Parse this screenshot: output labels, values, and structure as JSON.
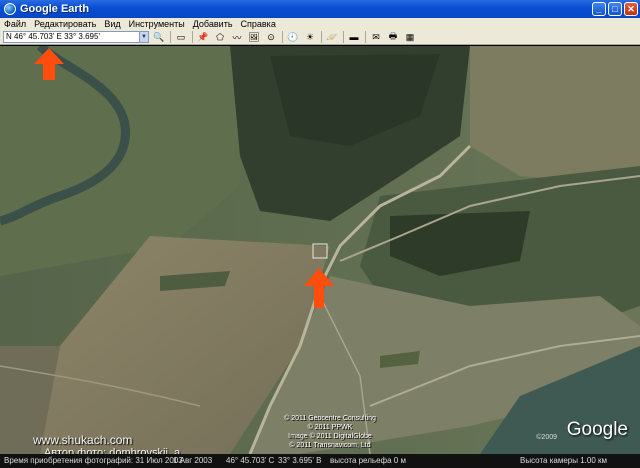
{
  "window": {
    "title": "Google Earth",
    "buttons": [
      "_",
      "□",
      "✕"
    ]
  },
  "menu": {
    "items": [
      "Файл",
      "Редактировать",
      "Вид",
      "Инструменты",
      "Добавить",
      "Справка"
    ]
  },
  "toolbar": {
    "search_value": "N 46° 45.703' E 33° 3.695'",
    "dropdown_glyph": "▼",
    "search_glyph": "🔍",
    "icons": [
      {
        "name": "sidebar-toggle-icon",
        "glyph": "▭"
      },
      {
        "name": "placemark-icon",
        "glyph": "📌"
      },
      {
        "name": "polygon-icon",
        "glyph": "⬠"
      },
      {
        "name": "path-icon",
        "glyph": "〰"
      },
      {
        "name": "image-overlay-icon",
        "glyph": "🖼"
      },
      {
        "name": "tour-icon",
        "glyph": "⊙"
      },
      {
        "name": "historical-imagery-icon",
        "glyph": "🕘"
      },
      {
        "name": "sunlight-icon",
        "glyph": "☀"
      },
      {
        "name": "planet-icon",
        "glyph": "🪐"
      },
      {
        "name": "ruler-icon",
        "glyph": "▬"
      },
      {
        "name": "email-icon",
        "glyph": "✉"
      },
      {
        "name": "print-icon",
        "glyph": "🖶"
      },
      {
        "name": "maps-icon",
        "glyph": "▦"
      }
    ]
  },
  "map": {
    "credits": [
      "© 2011 Geocentre Consulting",
      "© 2011 PPWK",
      "Image © 2011 DigitalGlobe",
      "© 2011 Transnavicom, Ltd"
    ],
    "logo_text": "Google",
    "logo_year": "©2009",
    "site_watermark": "www.shukach.com",
    "author_watermark": "Автор фото: dombrovskii_a",
    "colors": {
      "arrow": "#ff4d0d",
      "water": "#3e5a52",
      "field": "#8a8368",
      "marsh": "#2f3d2a"
    }
  },
  "statusbar": {
    "imagery_date_label": "Время приобретения фотографий: 31 Июл 2003",
    "date_range": "1 Авг 2003",
    "lat": "46° 45.703' С",
    "lon": "33° 3.695' В",
    "elevation": "высота рельефа 0 м",
    "eye_alt": "Высота камеры 1.00 км"
  }
}
